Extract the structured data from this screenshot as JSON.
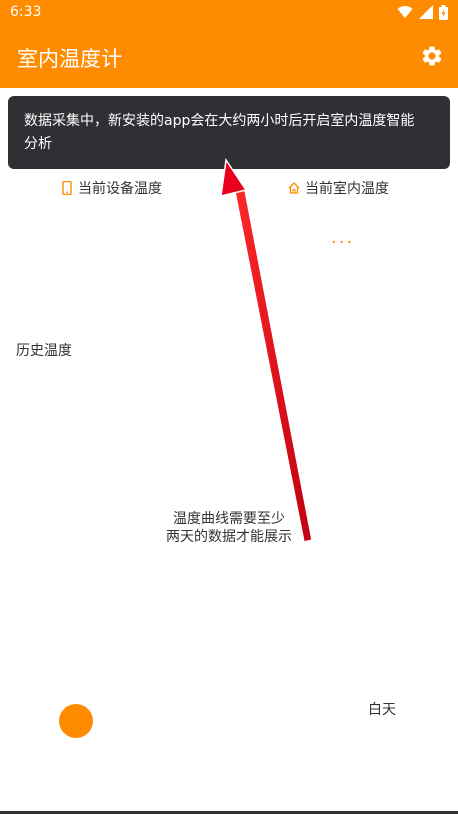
{
  "status_bar": {
    "time": "6:33",
    "icons": [
      "wifi-icon",
      "signal-icon",
      "battery-icon"
    ]
  },
  "app_bar": {
    "title": "室内温度计",
    "settings_icon": "gear-icon",
    "background_color": "#ff8c00"
  },
  "toast": {
    "message_line1": "数据采集中，新安装的app会在大约两小时后开启室内温度智能",
    "message_line2": "分析"
  },
  "current": {
    "device_label": "当前设备温度",
    "device_icon": "phone-icon",
    "room_label": "当前室内温度",
    "room_icon": "home-icon",
    "loading_indicator": "···"
  },
  "history": {
    "title": "历史温度",
    "empty_message": "温度曲线需要至少\n两天的数据才能展示"
  },
  "mode": {
    "label": "白天",
    "indicator_color": "#ff8c00"
  },
  "annotation": {
    "arrow_color": "#e8001c"
  }
}
